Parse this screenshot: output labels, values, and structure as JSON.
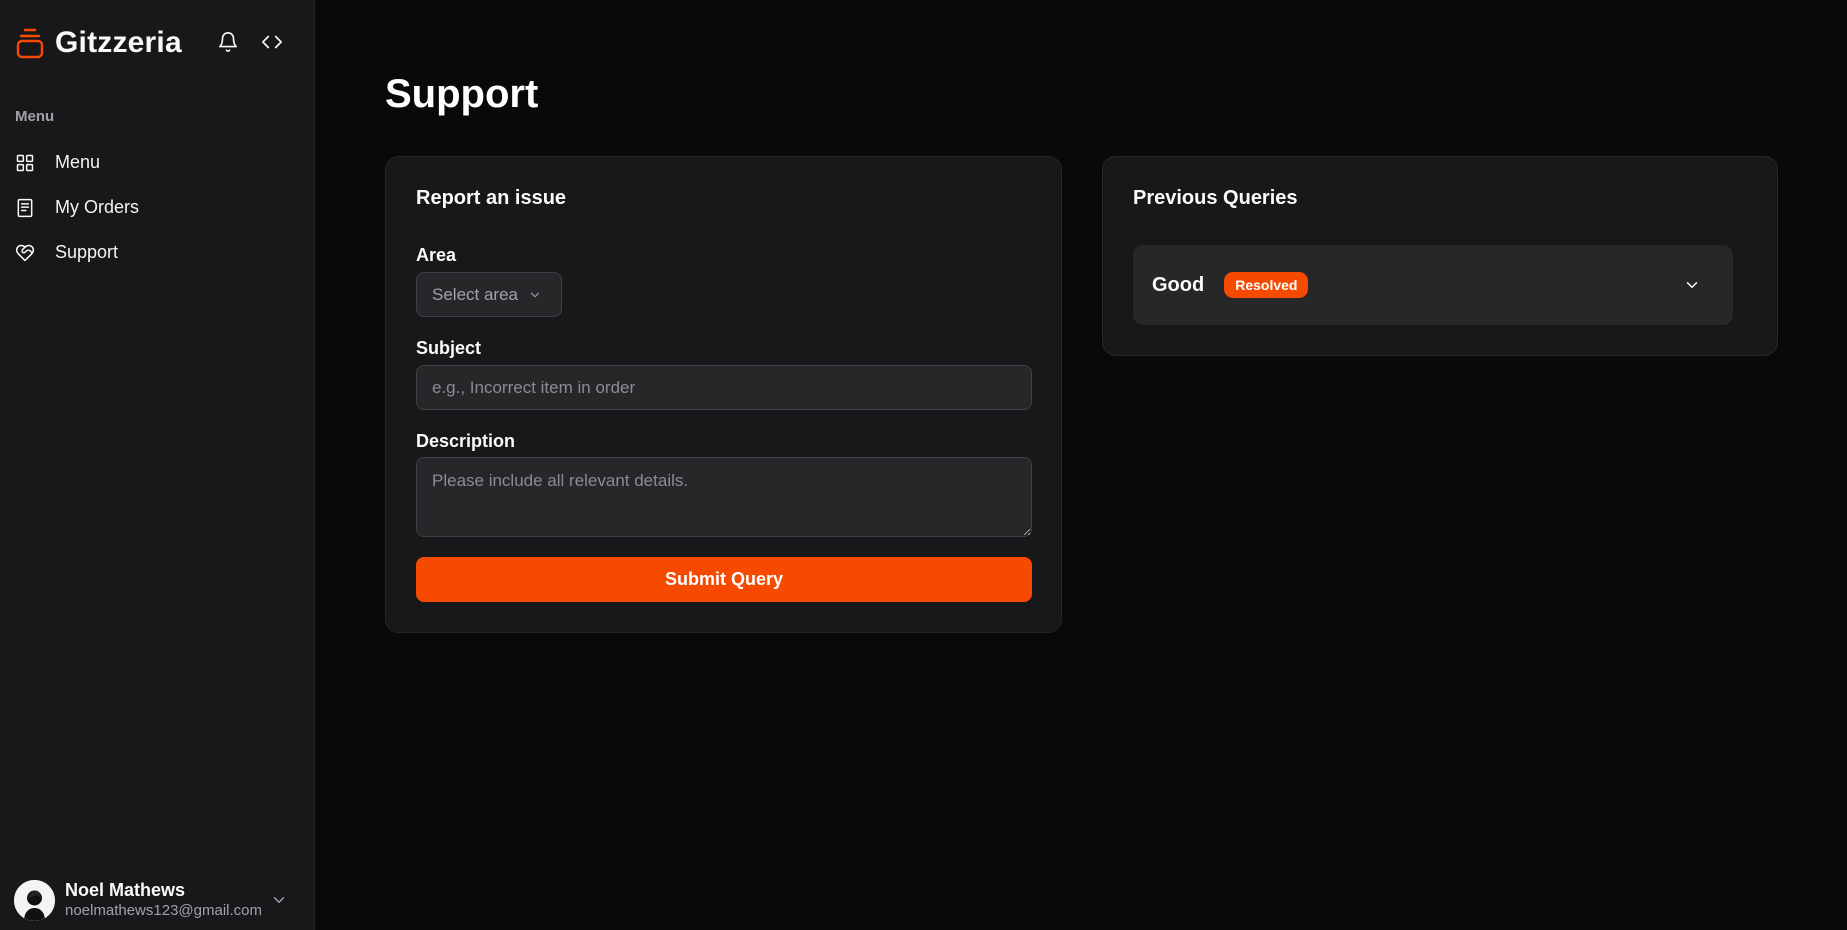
{
  "brand": {
    "name": "Gitzzeria",
    "accent": "#f54a00"
  },
  "topbar": {
    "notifications_icon": "bell-icon",
    "code_icon": "code-icon"
  },
  "sidebar": {
    "heading": "Menu",
    "items": [
      {
        "label": "Menu",
        "icon": "grid-icon"
      },
      {
        "label": "My Orders",
        "icon": "receipt-icon"
      },
      {
        "label": "Support",
        "icon": "heart-handshake-icon"
      }
    ]
  },
  "user": {
    "name": "Noel Mathews",
    "email": "noelmathews123@gmail.com"
  },
  "page": {
    "title": "Support"
  },
  "report": {
    "title": "Report an issue",
    "area_label": "Area",
    "area_placeholder": "Select area",
    "subject_label": "Subject",
    "subject_placeholder": "e.g., Incorrect item in order",
    "description_label": "Description",
    "description_placeholder": "Please include all relevant details.",
    "submit_label": "Submit Query"
  },
  "previous": {
    "title": "Previous Queries",
    "queries": [
      {
        "title": "Good",
        "status": "Resolved",
        "status_color": "#f54a00"
      }
    ]
  }
}
